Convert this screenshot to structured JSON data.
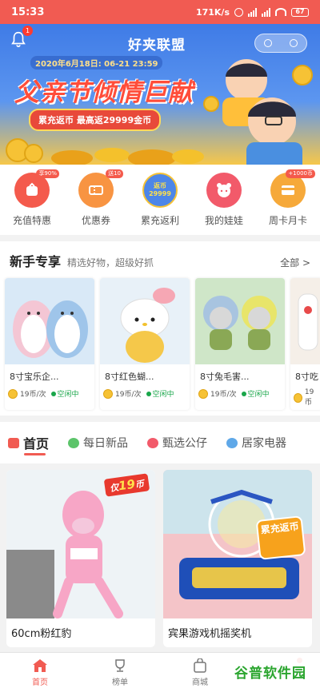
{
  "statusbar": {
    "time": "15:33",
    "speed": "171K/s",
    "battery": "67"
  },
  "banner": {
    "app_title": "好夹联盟",
    "notification_count": "1",
    "date_range": "2020年6月18日: 06-21 23:59",
    "headline": "父亲节倾情巨献",
    "subline": "累充返币 最高返29999金币"
  },
  "categories": [
    {
      "label": "充值特惠",
      "tag": "享90%",
      "color": "#f45a4c"
    },
    {
      "label": "优惠券",
      "tag": "送10",
      "color": "#f89442"
    },
    {
      "label": "累充返利",
      "tag": "",
      "color": "#4d86e8",
      "inner": "返币 29999"
    },
    {
      "label": "我的娃娃",
      "tag": "",
      "color": "#f25a6a"
    },
    {
      "label": "周卡月卡",
      "tag": "+1000币",
      "color": "#f6a93a"
    }
  ],
  "newbie": {
    "title": "新手专享",
    "subtitle": "精选好物，超级好抓",
    "all_label": "全部 >",
    "products": [
      {
        "name": "8寸宝乐企...",
        "price": "19币/次",
        "status": "空闲中"
      },
      {
        "name": "8寸红色蝴...",
        "price": "19币/次",
        "status": "空闲中"
      },
      {
        "name": "8寸兔毛害...",
        "price": "19币/次",
        "status": "空闲中"
      },
      {
        "name": "8寸吃",
        "price": "19币",
        "status": ""
      }
    ]
  },
  "tabs": [
    {
      "label": "首页",
      "active": true
    },
    {
      "label": "每日新品",
      "active": false
    },
    {
      "label": "甄选公仔",
      "active": false
    },
    {
      "label": "居家电器",
      "active": false
    }
  ],
  "grid": [
    {
      "name": "60cm粉红豹",
      "price_prefix": "仅",
      "price": "19",
      "price_suffix": "币"
    },
    {
      "name": "宾果游戏机摇奖机",
      "badge": "累充返币"
    }
  ],
  "bottom_nav": [
    {
      "label": "首页",
      "active": true
    },
    {
      "label": "榜单",
      "active": false
    },
    {
      "label": "商城",
      "active": false
    },
    {
      "label": "",
      "active": false
    }
  ],
  "watermark": "谷普软件园"
}
